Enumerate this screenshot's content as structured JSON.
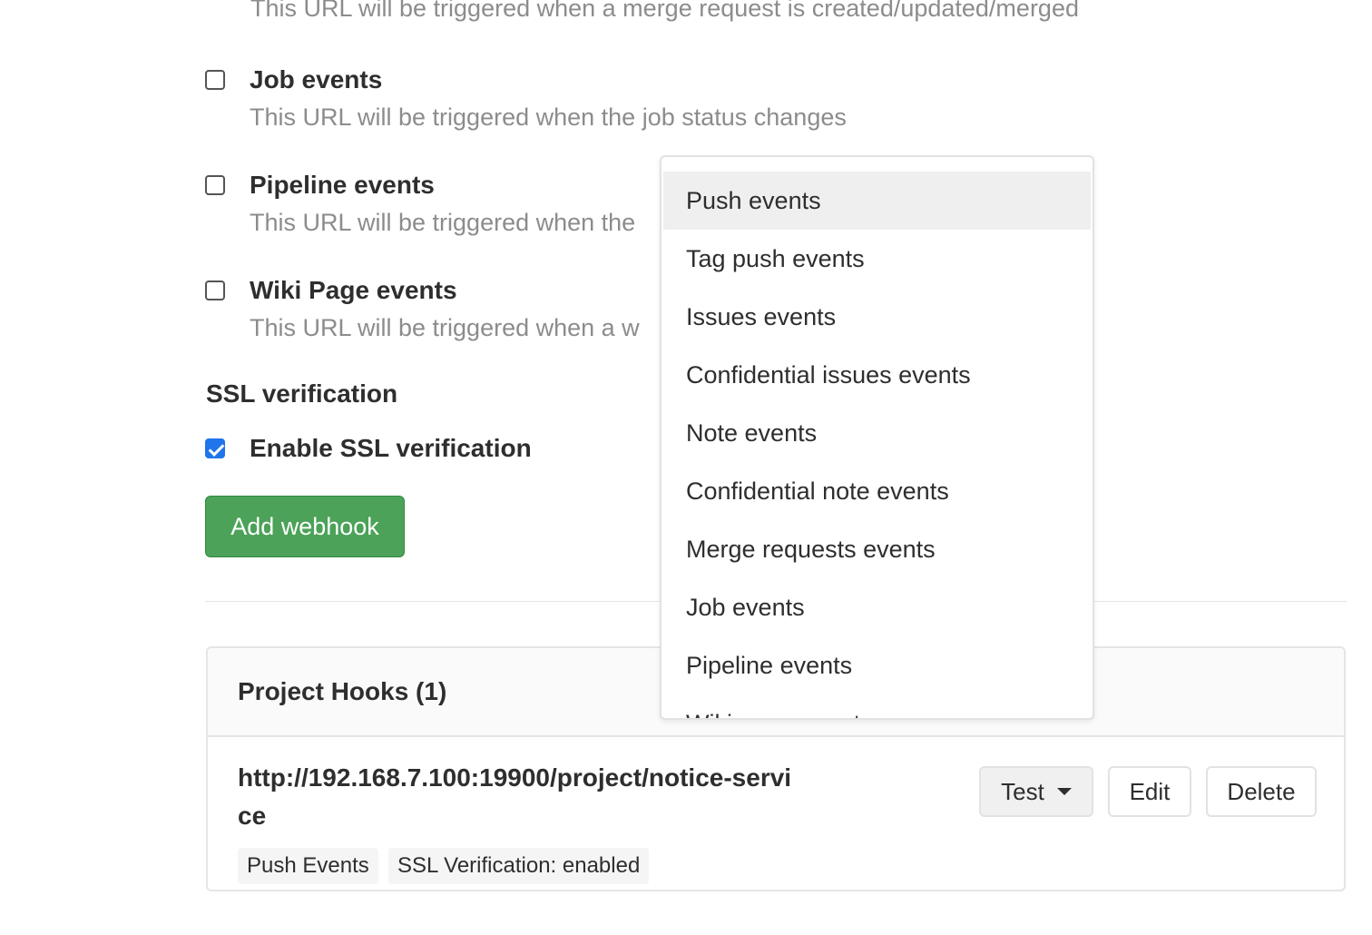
{
  "top_description": "This URL will be triggered when a merge request is created/updated/merged",
  "events": [
    {
      "title": "Job events",
      "description": "This URL will be triggered when the job status changes",
      "checked": false
    },
    {
      "title": "Pipeline events",
      "description": "This URL will be triggered when the",
      "checked": false
    },
    {
      "title": "Wiki Page events",
      "description": "This URL will be triggered when a w",
      "checked": false
    }
  ],
  "ssl": {
    "heading": "SSL verification",
    "checkbox_label": "Enable SSL verification",
    "checked": true
  },
  "add_button_label": "Add webhook",
  "hooks": {
    "title": "Project Hooks (1)",
    "url": "http://192.168.7.100:19900/project/notice-service",
    "badges": [
      "Push Events",
      "SSL Verification: enabled"
    ],
    "test_label": "Test",
    "edit_label": "Edit",
    "delete_label": "Delete"
  },
  "dropdown": {
    "items": [
      "Push events",
      "Tag push events",
      "Issues events",
      "Confidential issues events",
      "Note events",
      "Confidential note events",
      "Merge requests events",
      "Job events",
      "Pipeline events",
      "Wiki page events"
    ],
    "highlighted": "Push events"
  },
  "colors": {
    "primary_button": "#4ba258",
    "checkbox_checked": "#1f75ea",
    "muted_text": "#8c8c8c"
  }
}
